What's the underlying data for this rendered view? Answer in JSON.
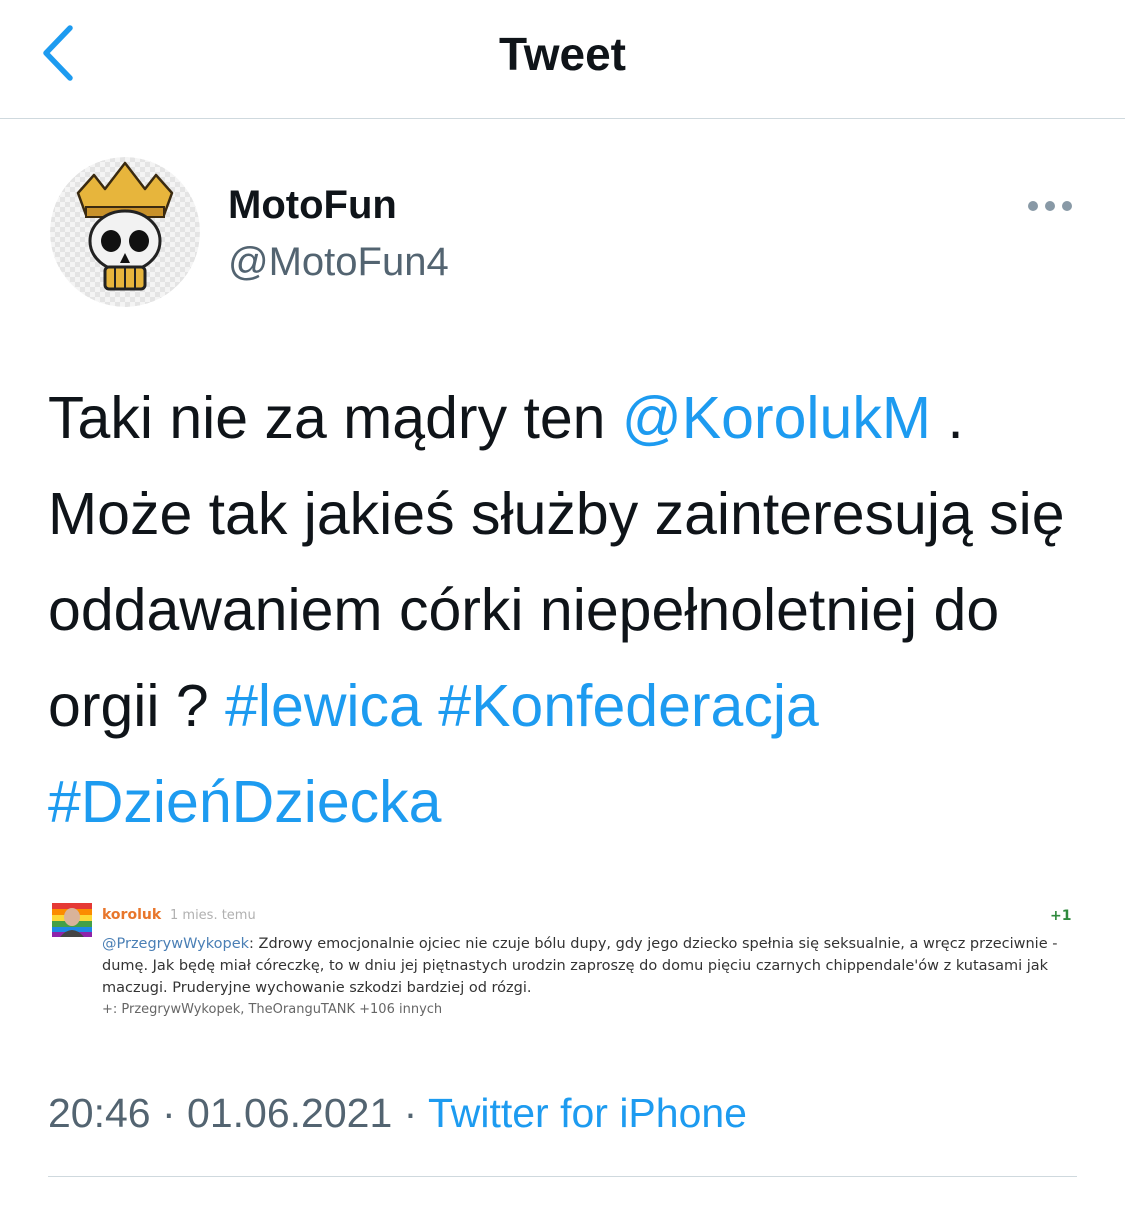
{
  "header": {
    "title": "Tweet",
    "back_icon": "chevron-left-icon"
  },
  "author": {
    "name": "MotoFun",
    "handle": "@MotoFun4",
    "avatar_icon": "crowned-skull-avatar"
  },
  "more_icon": "more-horizontal-icon",
  "tweet": {
    "text_1": "Taki nie za mądry ten ",
    "mention": "@KorolukM",
    "text_2": " . Może tak jakieś służby zainteresują się oddawaniem córki niepełnoletniej do orgii ? ",
    "hashtag_1": "#lewica",
    "hashtag_2": "#Konfederacja",
    "hashtag_3": "#DzieńDziecka"
  },
  "media": {
    "username": "koroluk",
    "time": "1 mies. temu",
    "plus": "+1",
    "mention": "@PrzegrywWykopek",
    "body": ": Zdrowy emocjonalnie ojciec nie czuje bólu dupy, gdy jego dziecko spełnia się seksualnie, a wręcz przeciwnie - dumę. Jak będę miał córeczkę, to w dniu jej piętnastych urodzin zaproszę do domu pięciu czarnych chippendale'ów z kutasami jak maczugi. Pruderyjne wychowanie szkodzi bardziej od rózgi.",
    "footer": "+: PrzegrywWykopek, TheOranguTANK +106 innych"
  },
  "meta": {
    "time": "20:46",
    "separator": " · ",
    "date": "01.06.2021",
    "source": "Twitter for iPhone"
  },
  "colors": {
    "link": "#1d9bf0",
    "secondary": "#536471",
    "text": "#0f1419",
    "divider": "#cfd9de"
  }
}
